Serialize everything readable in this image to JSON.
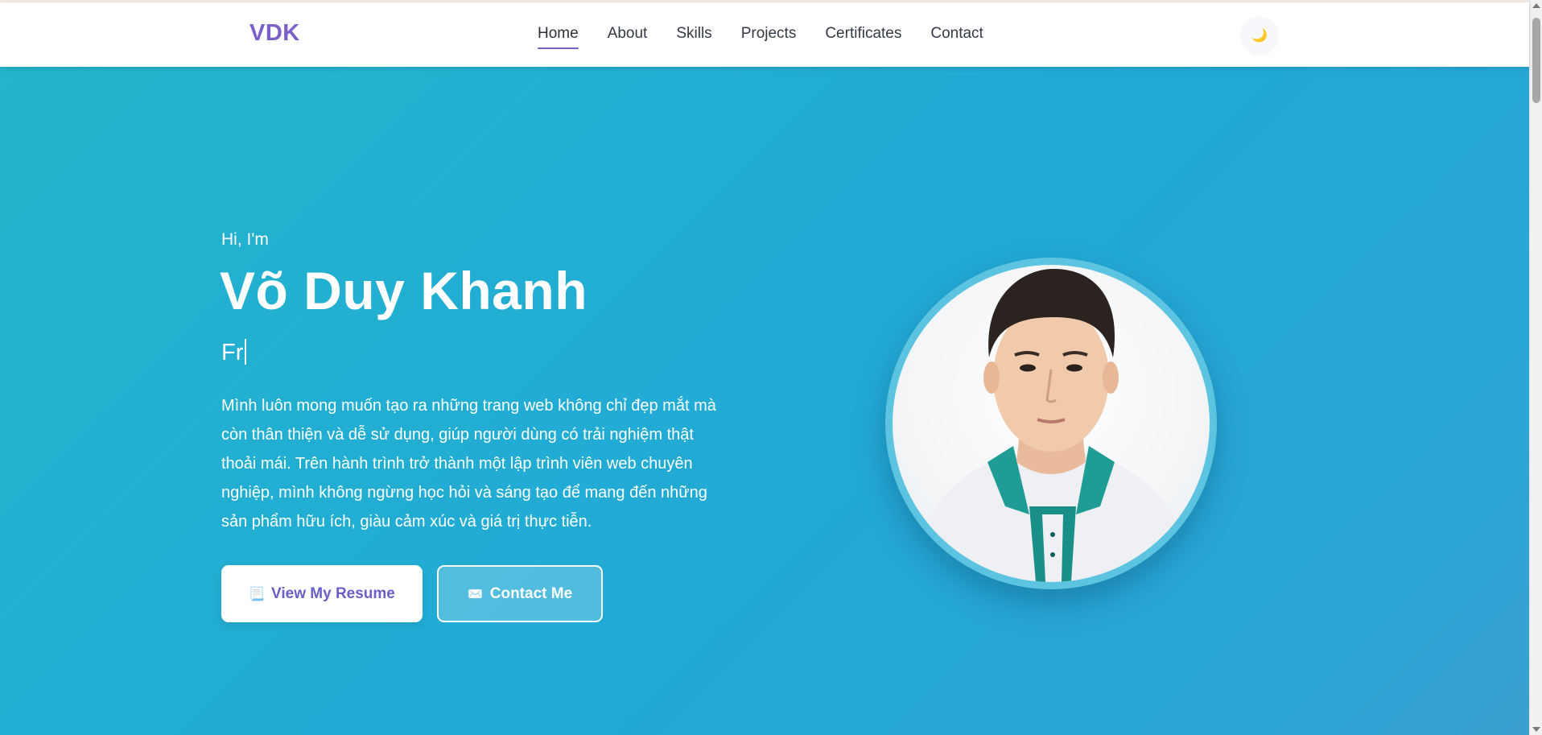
{
  "navbar": {
    "logo": "VDK",
    "links": [
      "Home",
      "About",
      "Skills",
      "Projects",
      "Certificates",
      "Contact"
    ],
    "active_link": "Home",
    "theme_toggle_icon": "🌙"
  },
  "hero": {
    "greeting": "Hi, I'm",
    "name": "Võ Duy Khanh",
    "typing_text": "Fr",
    "bio": "Mình luôn mong muốn tạo ra những trang web không chỉ đẹp mắt mà còn thân thiện và dễ sử dụng, giúp người dùng có trải nghiệm thật thoải mái. Trên hành trình trở thành một lập trình viên web chuyên nghiệp, mình không ngừng học hỏi và sáng tạo để mang đến những sản phẩm hữu ích, giàu cảm xúc và giá trị thực tiễn.",
    "resume_button": {
      "icon": "📃",
      "label": "View My Resume"
    },
    "contact_button": {
      "icon": "✉️",
      "label": "Contact Me"
    }
  },
  "colors": {
    "accent": "#7b5fc9",
    "hero_bg_start": "#23b5cc",
    "hero_bg_end": "#22a9d6",
    "ring": "#5cc4e0"
  }
}
